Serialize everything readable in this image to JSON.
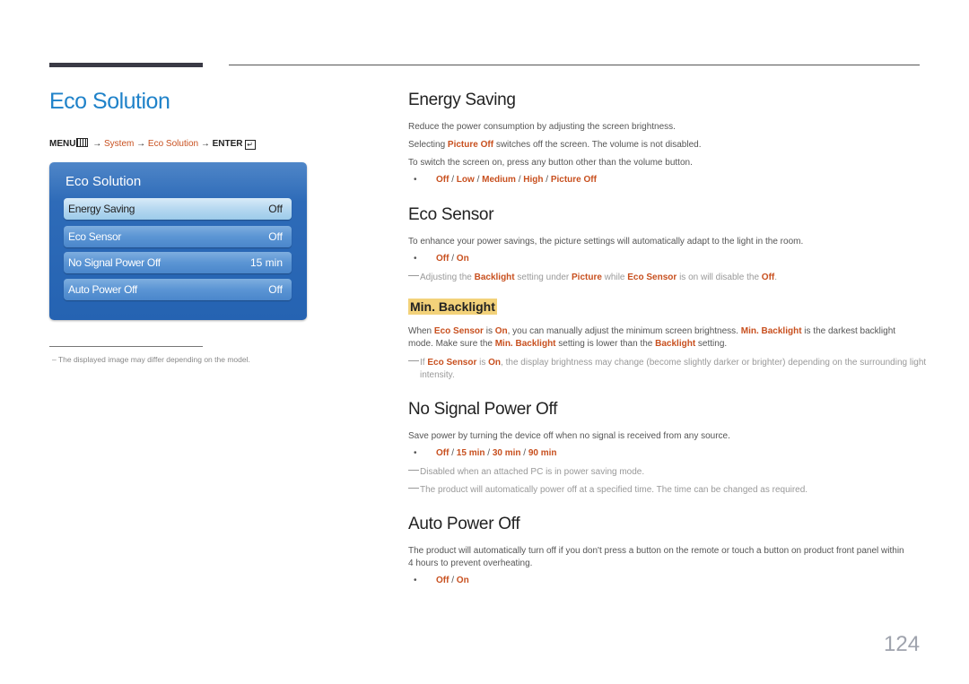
{
  "page": {
    "title": "Eco Solution",
    "page_number": "124"
  },
  "menu_path": {
    "menu": "MENU",
    "menu_icon": "menu-grid-icon",
    "arrow": "→",
    "system": "System",
    "eco_solution": "Eco Solution",
    "enter": "ENTER",
    "enter_icon": "enter-icon"
  },
  "osd": {
    "title": "Eco Solution",
    "items": [
      {
        "label": "Energy Saving",
        "value": "Off",
        "selected": true
      },
      {
        "label": "Eco Sensor",
        "value": "Off",
        "selected": false
      },
      {
        "label": "No Signal Power Off",
        "value": "15 min",
        "selected": false
      },
      {
        "label": "Auto Power Off",
        "value": "Off",
        "selected": false
      }
    ]
  },
  "footnote": "–  The displayed image may differ depending on the model.",
  "sections": {
    "energy_saving": {
      "heading": "Energy Saving",
      "line1": "Reduce the power consumption by adjusting the screen brightness.",
      "line2_pre": "Selecting ",
      "line2_hl": "Picture Off",
      "line2_post": " switches off the screen. The volume is not disabled.",
      "line3": "To switch the screen on, press any button other than the volume button.",
      "options": [
        "Off",
        "Low",
        "Medium",
        "High",
        "Picture Off"
      ]
    },
    "eco_sensor": {
      "heading": "Eco Sensor",
      "desc": "To enhance your power savings, the picture settings will automatically adapt to the light in the room.",
      "options": [
        "Off",
        "On"
      ],
      "note": {
        "p1": "Adjusting the ",
        "h1": "Backlight",
        "p2": " setting under ",
        "h2": "Picture",
        "p3": " while ",
        "h3": "Eco Sensor",
        "p4": " is on will disable the ",
        "h4": "Off",
        "p5": "."
      }
    },
    "min_backlight": {
      "heading": "Min. Backlight",
      "desc": {
        "p1": "When ",
        "h1": "Eco Sensor",
        "p2": " is ",
        "h2": "On",
        "p3": ", you can manually adjust the minimum screen brightness. ",
        "h3": "Min. Backlight",
        "p4": " is the darkest backlight mode. Make sure the ",
        "h4": "Min. Backlight",
        "p5": " setting is lower than the ",
        "h5": "Backlight",
        "p6": " setting."
      },
      "note": {
        "p1": "If ",
        "h1": "Eco Sensor",
        "p2": " is ",
        "h2": "On",
        "p3": ", the display brightness may change (become slightly darker or brighter) depending on the surrounding light intensity."
      }
    },
    "no_signal": {
      "heading": "No Signal Power Off",
      "desc": "Save power by turning the device off when no signal is received from any source.",
      "options": [
        "Off",
        "15 min",
        "30 min",
        "90 min"
      ],
      "notes": [
        "Disabled when an attached PC is in power saving mode.",
        "The product will automatically power off at a specified time. The time can be changed as required."
      ]
    },
    "auto_power_off": {
      "heading": "Auto Power Off",
      "desc": "The product will automatically turn off if you don't press a button on the remote or touch a button on product front panel within 4 hours to prevent overheating.",
      "options": [
        "Off",
        "On"
      ]
    }
  },
  "separator": " / ",
  "bullet": "•",
  "colors": {
    "title_blue": "#1f82c9",
    "highlight_red": "#c8501f",
    "subhead_bg": "#f3d27a",
    "osd_blue": "#2563b2"
  }
}
